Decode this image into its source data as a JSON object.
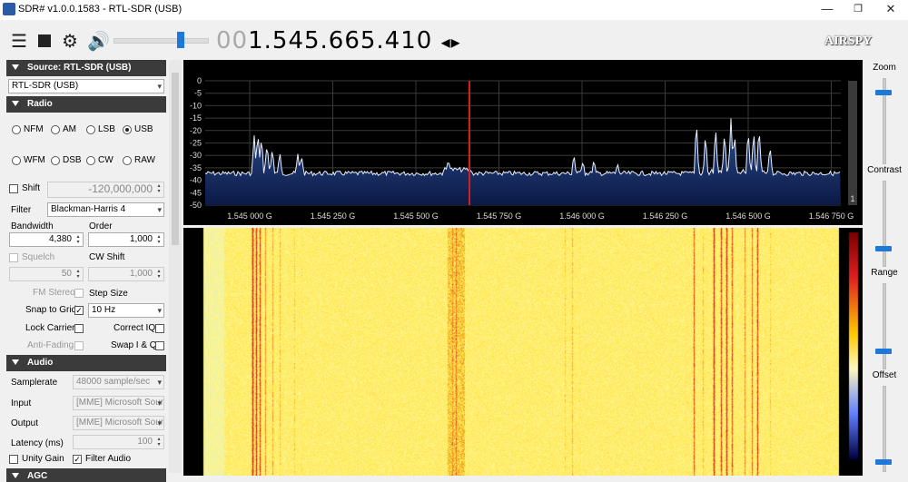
{
  "window": {
    "title": "SDR# v1.0.0.1583 - RTL-SDR (USB)",
    "minimize": "—",
    "maximize": "❐",
    "close": "✕"
  },
  "toolbar": {
    "frequency_lead": "00",
    "frequency": "1.545.665.410",
    "freq_arrows": "◂▸",
    "logo": "AIRSPY",
    "volume_level": 0.72
  },
  "source": {
    "header": "Source: RTL-SDR (USB)",
    "device": "RTL-SDR (USB)"
  },
  "radio": {
    "header": "Radio",
    "modes_row1": [
      "NFM",
      "AM",
      "LSB",
      "USB"
    ],
    "modes_row2": [
      "WFM",
      "DSB",
      "CW",
      "RAW"
    ],
    "selected_mode": "USB",
    "shift_label": "Shift",
    "shift_value": "-120,000,000",
    "filter_label": "Filter",
    "filter_value": "Blackman-Harris 4",
    "bandwidth_label": "Bandwidth",
    "bandwidth_value": "4,380",
    "order_label": "Order",
    "order_value": "1,000",
    "squelch_label": "Squelch",
    "squelch_value": "50",
    "cw_shift_label": "CW Shift",
    "cw_shift_value": "1,000",
    "fm_stereo_label": "FM Stereo",
    "step_size_label": "Step Size",
    "snap_label": "Snap to Grid",
    "step_value": "10 Hz",
    "lock_carrier_label": "Lock Carrier",
    "correct_iq_label": "Correct IQ",
    "anti_fading_label": "Anti-Fading",
    "swap_iq_label": "Swap I & Q"
  },
  "audio": {
    "header": "Audio",
    "samplerate_label": "Samplerate",
    "samplerate_value": "48000 sample/sec",
    "input_label": "Input",
    "input_value": "[MME] Microsoft Soun",
    "output_label": "Output",
    "output_value": "[MME] Microsoft Soun",
    "latency_label": "Latency (ms)",
    "latency_value": "100",
    "unity_gain_label": "Unity Gain",
    "filter_audio_label": "Filter Audio"
  },
  "agc": {
    "header": "AGC"
  },
  "right_panel": {
    "zoom": "Zoom",
    "contrast": "Contrast",
    "range": "Range",
    "offset": "Offset",
    "zoom_level": 0.89,
    "contrast_level": 0.2,
    "range_level": 0.2,
    "offset_level": 0.1
  },
  "spectrum": {
    "y_ticks": [
      "0",
      "-5",
      "-10",
      "-15",
      "-20",
      "-25",
      "-30",
      "-35",
      "-40",
      "-45",
      "-50"
    ],
    "x_ticks": [
      "1.545 000 G",
      "1.545 250 G",
      "1.545 500 G",
      "1.545 750 G",
      "1.546 000 G",
      "1.546 250 G",
      "1.546 500 G",
      "1.546 750 G"
    ],
    "marker_index": "1"
  }
}
